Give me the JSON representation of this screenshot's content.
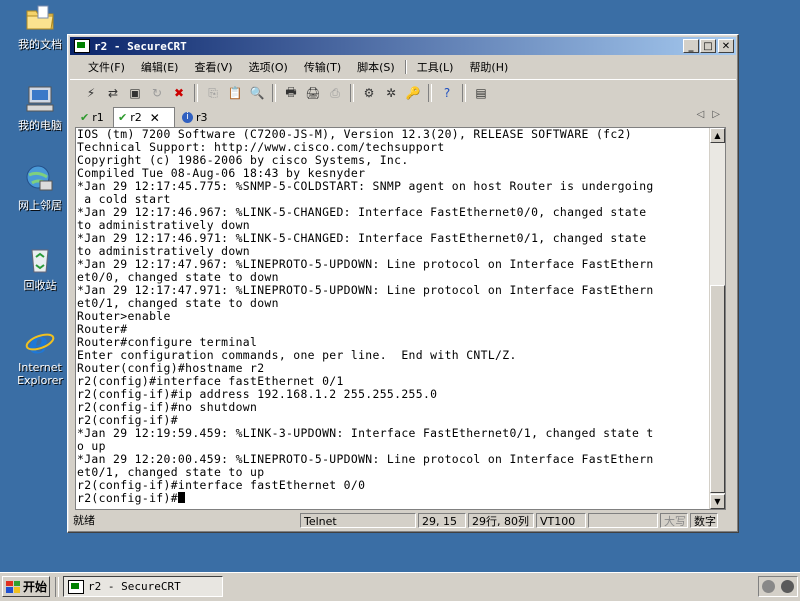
{
  "desktop": {
    "icons": [
      {
        "label": "我的文档",
        "icon": "folder-icon"
      },
      {
        "label": "我的电脑",
        "icon": "computer-icon"
      },
      {
        "label": "网上邻居",
        "icon": "network-icon"
      },
      {
        "label": "回收站",
        "icon": "recycle-bin-icon"
      },
      {
        "label": "Internet Explorer",
        "icon": "internet-explorer-icon"
      }
    ]
  },
  "window": {
    "title": "r2 - SecureCRT",
    "controls": {
      "minimize": "_",
      "maximize": "□",
      "close": "✕"
    },
    "menu": [
      "文件(F)",
      "编辑(E)",
      "查看(V)",
      "选项(O)",
      "传输(T)",
      "脚本(S)",
      "工具(L)",
      "帮助(H)"
    ],
    "tabs": [
      {
        "label": "r1",
        "status": "check"
      },
      {
        "label": "r2",
        "status": "check",
        "active": true
      },
      {
        "label": "r3",
        "status": "info"
      }
    ],
    "terminal_lines": [
      "IOS (tm) 7200 Software (C7200-JS-M), Version 12.3(20), RELEASE SOFTWARE (fc2)",
      "Technical Support: http://www.cisco.com/techsupport",
      "Copyright (c) 1986-2006 by cisco Systems, Inc.",
      "Compiled Tue 08-Aug-06 18:43 by kesnyder",
      "*Jan 29 12:17:45.775: %SNMP-5-COLDSTART: SNMP agent on host Router is undergoing",
      " a cold start",
      "*Jan 29 12:17:46.967: %LINK-5-CHANGED: Interface FastEthernet0/0, changed state",
      "to administratively down",
      "*Jan 29 12:17:46.971: %LINK-5-CHANGED: Interface FastEthernet0/1, changed state",
      "to administratively down",
      "*Jan 29 12:17:47.967: %LINEPROTO-5-UPDOWN: Line protocol on Interface FastEthern",
      "et0/0, changed state to down",
      "*Jan 29 12:17:47.971: %LINEPROTO-5-UPDOWN: Line protocol on Interface FastEthern",
      "et0/1, changed state to down",
      "Router>enable",
      "Router#",
      "Router#configure terminal",
      "Enter configuration commands, one per line.  End with CNTL/Z.",
      "Router(config)#hostname r2",
      "r2(config)#interface fastEthernet 0/1",
      "r2(config-if)#ip address 192.168.1.2 255.255.255.0",
      "r2(config-if)#no shutdown",
      "r2(config-if)#",
      "*Jan 29 12:19:59.459: %LINK-3-UPDOWN: Interface FastEthernet0/1, changed state t",
      "o up",
      "*Jan 29 12:20:00.459: %LINEPROTO-5-UPDOWN: Line protocol on Interface FastEthern",
      "et0/1, changed state to up",
      "r2(config-if)#interface fastEthernet 0/0"
    ],
    "prompt": "r2(config-if)#",
    "status": {
      "ready": "就绪",
      "protocol": "Telnet",
      "cursor_pos": "29, 15",
      "size": "29行, 80列",
      "emulation": "VT100",
      "caps": "大写",
      "num": "数字"
    }
  },
  "taskbar": {
    "start_label": "开始",
    "task_title": "r2 - SecureCRT"
  }
}
